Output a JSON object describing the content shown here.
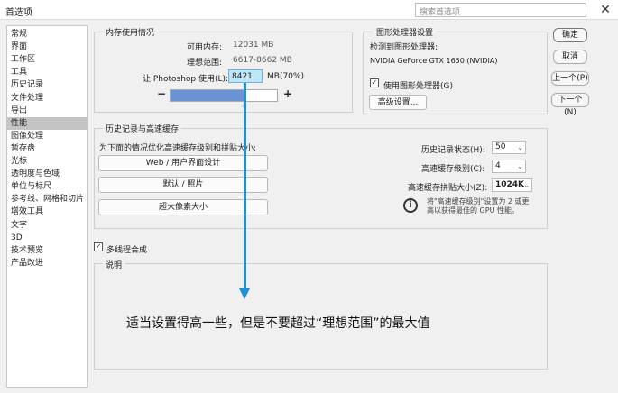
{
  "window": {
    "title": "首选项",
    "search_placeholder": "搜索首选项",
    "close_glyph": "✕"
  },
  "sidebar": {
    "items": [
      {
        "label": "常规"
      },
      {
        "label": "界面"
      },
      {
        "label": "工作区"
      },
      {
        "label": "工具"
      },
      {
        "label": "历史记录"
      },
      {
        "label": "文件处理"
      },
      {
        "label": "导出"
      },
      {
        "label": "性能",
        "selected": true
      },
      {
        "label": "图像处理"
      },
      {
        "label": "暂存盘"
      },
      {
        "label": "光标"
      },
      {
        "label": "透明度与色域"
      },
      {
        "label": "单位与标尺"
      },
      {
        "label": "参考线、网格和切片"
      },
      {
        "label": "增效工具"
      },
      {
        "label": "文字"
      },
      {
        "label": "3D"
      },
      {
        "label": "技术预览"
      },
      {
        "label": "产品改进"
      }
    ]
  },
  "memory": {
    "group_title": "内存使用情况",
    "available_label": "可用内存:",
    "available_value": "12031 MB",
    "ideal_label": "理想范围:",
    "ideal_value": "6617-8662 MB",
    "let_label": "让 Photoshop 使用(L):",
    "let_value": "8421",
    "unit_label": "MB(70%)",
    "minus": "−",
    "plus": "+",
    "slider_fraction": 0.7
  },
  "gpu": {
    "group_title": "图形处理器设置",
    "detected_label": "检测到图形处理器:",
    "gpu_name": "NVIDIA GeForce GTX 1650 (NVIDIA)",
    "use_gpu_label": "使用图形处理器(G)",
    "use_gpu_checked": true,
    "advanced_button": "高级设置..."
  },
  "history": {
    "group_title": "历史记录与高速缓存",
    "optimize_label": "为下面的情况优化高速缓存级别和拼贴大小:",
    "buttons": [
      "Web / 用户界面设计",
      "默认 / 照片",
      "超大像素大小"
    ],
    "history_states_label": "历史记录状态(H):",
    "history_states_value": "50",
    "cache_levels_label": "高速缓存级别(C):",
    "cache_levels_value": "4",
    "tile_size_label": "高速缓存拼贴大小(Z):",
    "tile_size_value": "1024K",
    "info_text_1": "将\"高速缓存级别\"设置为 2 或更",
    "info_text_2": "高以获得最佳的 GPU 性能。"
  },
  "multithread": {
    "label": "多线程合成",
    "checked": true
  },
  "description": {
    "group_title": "说明"
  },
  "annotation": {
    "text": "适当设置得高一些，但是不要超过“理想范围”的最大值",
    "color": "#1e90d6"
  },
  "actions": {
    "ok": "确定",
    "cancel": "取消",
    "prev": "上一个(P)",
    "next": "下一个(N)"
  }
}
